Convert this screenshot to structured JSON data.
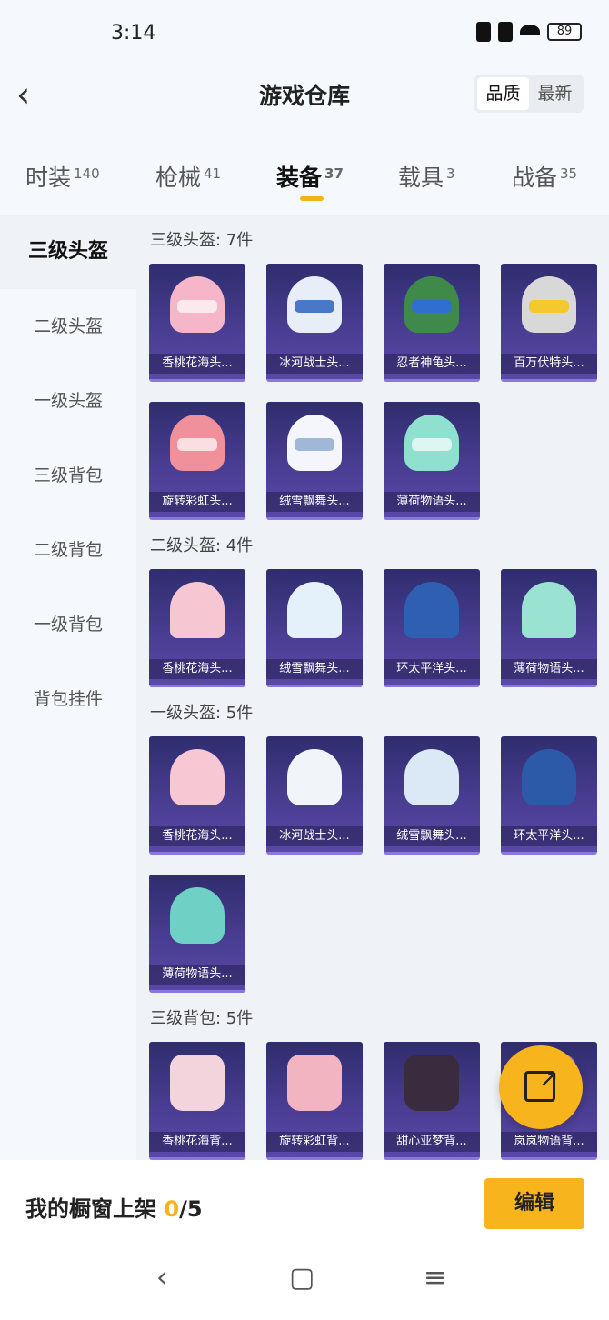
{
  "status": {
    "time": "3:14",
    "battery": "89"
  },
  "header": {
    "title": "游戏仓库",
    "sort_quality": "品质",
    "sort_latest": "最新",
    "back_glyph": "‹"
  },
  "tabs": [
    {
      "label": "时装",
      "count": "140"
    },
    {
      "label": "枪械",
      "count": "41"
    },
    {
      "label": "装备",
      "count": "37"
    },
    {
      "label": "载具",
      "count": "3"
    },
    {
      "label": "战备",
      "count": "35"
    }
  ],
  "sidebar": [
    "三级头盔",
    "二级头盔",
    "一级头盔",
    "三级背包",
    "二级背包",
    "一级背包",
    "背包挂件"
  ],
  "sections": [
    {
      "title": "三级头盔: 7件",
      "items": [
        "香桃花海头...",
        "冰河战士头...",
        "忍者神龟头...",
        "百万伏特头...",
        "旋转彩虹头...",
        "绒雪飘舞头...",
        "薄荷物语头..."
      ]
    },
    {
      "title": "二级头盔: 4件",
      "items": [
        "香桃花海头...",
        "绒雪飘舞头...",
        "环太平洋头...",
        "薄荷物语头..."
      ]
    },
    {
      "title": "一级头盔: 5件",
      "items": [
        "香桃花海头...",
        "冰河战士头...",
        "绒雪飘舞头...",
        "环太平洋头...",
        "薄荷物语头..."
      ]
    },
    {
      "title": "三级背包: 5件",
      "items": [
        "香桃花海背...",
        "旋转彩虹背...",
        "甜心亚梦背...",
        "岚岚物语背..."
      ]
    }
  ],
  "footer": {
    "label": "我的橱窗上架",
    "current": "0",
    "total": "/5",
    "edit": "编辑"
  },
  "nav": {
    "back": "‹",
    "home": "▢",
    "menu": "≡"
  },
  "colors": {
    "accent": "#f7b41d",
    "card_top": "#2f2d6e",
    "card_bottom": "#5a48a8"
  }
}
